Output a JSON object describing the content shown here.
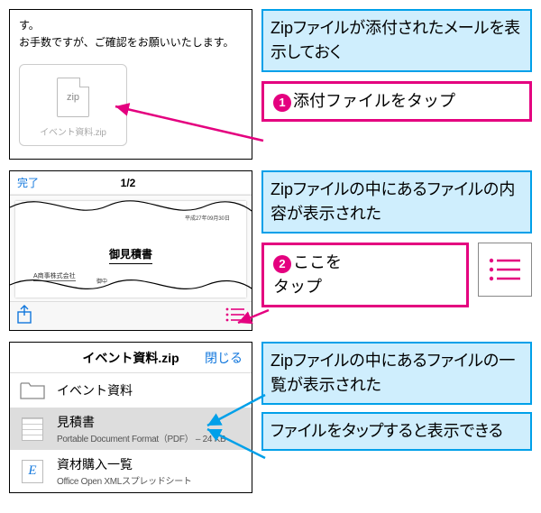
{
  "shot1": {
    "email_line1": "す。",
    "email_line2": "お手数ですが、ご確認をお願いいたします。",
    "attachment_ext": "zip",
    "attachment_name": "イベント資料.zip"
  },
  "callout1a": "Zipファイルが添付されたメールを表示しておく",
  "callout1b_num": "1",
  "callout1b": "添付ファイルをタップ",
  "shot2": {
    "done": "完了",
    "page": "1/2",
    "doc_title": "御見積書",
    "doc_date": "平成27年09月30日",
    "company": "A商事株式会社",
    "stamp": "御中"
  },
  "callout2a": "Zipファイルの中にあるファイルの内容が表示された",
  "callout2b_num": "2",
  "callout2b1": "ここを",
  "callout2b2": "タップ",
  "shot3": {
    "title": "イベント資料.zip",
    "close": "閉じる",
    "rows": [
      {
        "name": "イベント資料",
        "sub": ""
      },
      {
        "name": "見積書",
        "sub": "Portable Document Format（PDF） – 24 KB"
      },
      {
        "name": "資材購入一覧",
        "sub": "Office Open XMLスプレッドシート"
      }
    ]
  },
  "callout3a": "Zipファイルの中にあるファイルの一覧が表示された",
  "callout3b": "ファイルをタップすると表示できる"
}
